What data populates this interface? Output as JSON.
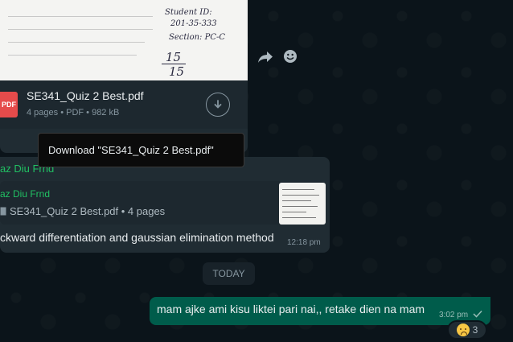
{
  "document_message": {
    "preview_lines": [
      "Student ID:",
      "201-35-333",
      "Section: PC-C",
      "15",
      "15"
    ],
    "file_name": "SE341_Quiz 2 Best.pdf",
    "file_icon_label": "PDF",
    "file_meta": "4 pages • PDF • 982 kB",
    "download_icon": "download-arrow-icon"
  },
  "tooltip": {
    "text": "Download \"SE341_Quiz 2 Best.pdf\""
  },
  "reply_message": {
    "sender": "az Diu Frnd",
    "quoted_sender": "az Diu Frnd",
    "quoted_file": "SE341_Quiz 2 Best.pdf • 4 pages",
    "text": "ckward differentiation and gaussian elimination method",
    "time": "12:18 pm"
  },
  "date_divider": {
    "label": "TODAY"
  },
  "outgoing_message": {
    "text": "mam ajke ami kisu liktei pari nai,, retake dien na mam",
    "time": "3:02 pm",
    "reaction_count": "3"
  },
  "colors": {
    "background": "#0b141a",
    "incoming_bubble": "#202c33",
    "outgoing_bubble": "#005c4b",
    "sender_green": "#21c063",
    "pdf_red": "#e54b4b"
  }
}
